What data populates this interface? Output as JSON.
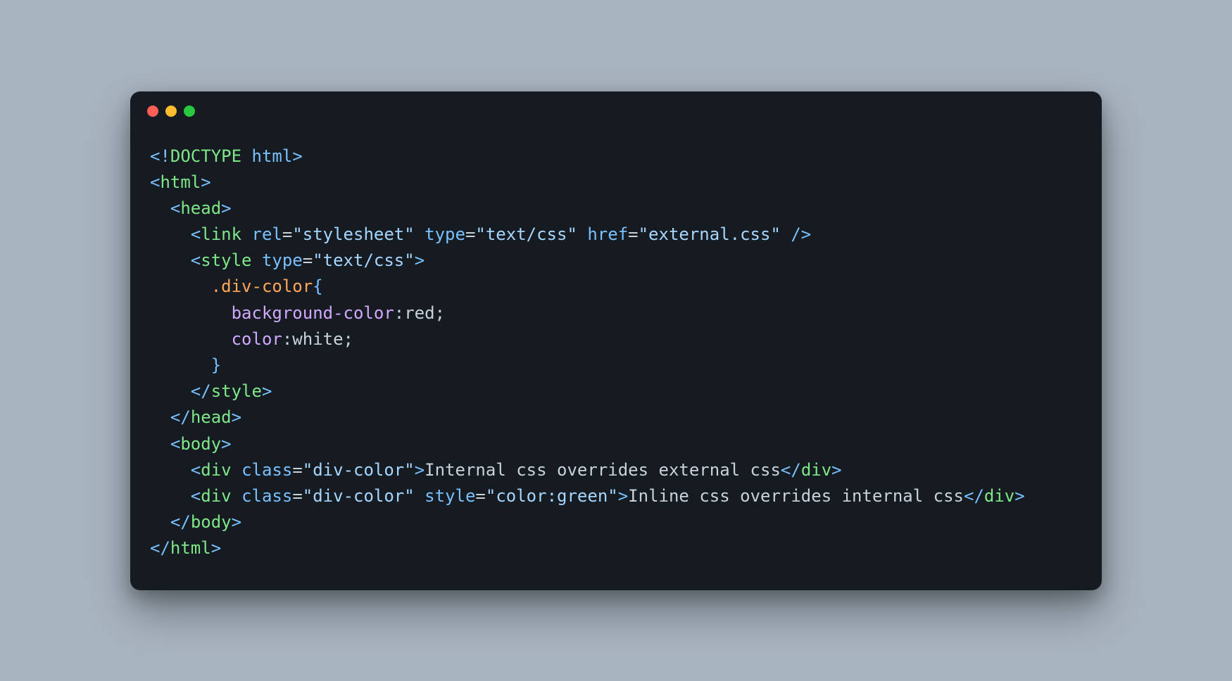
{
  "code": {
    "lines": [
      [
        {
          "cls": "bracket",
          "t": "<!"
        },
        {
          "cls": "tag",
          "t": "DOCTYPE"
        },
        {
          "cls": "text",
          "t": " "
        },
        {
          "cls": "attr",
          "t": "html"
        },
        {
          "cls": "bracket",
          "t": ">"
        }
      ],
      [
        {
          "cls": "bracket",
          "t": "<"
        },
        {
          "cls": "tag",
          "t": "html"
        },
        {
          "cls": "bracket",
          "t": ">"
        }
      ],
      [
        {
          "cls": "text",
          "t": "  "
        },
        {
          "cls": "bracket",
          "t": "<"
        },
        {
          "cls": "tag",
          "t": "head"
        },
        {
          "cls": "bracket",
          "t": ">"
        }
      ],
      [
        {
          "cls": "text",
          "t": "    "
        },
        {
          "cls": "bracket",
          "t": "<"
        },
        {
          "cls": "tag",
          "t": "link"
        },
        {
          "cls": "text",
          "t": " "
        },
        {
          "cls": "attr",
          "t": "rel"
        },
        {
          "cls": "text",
          "t": "="
        },
        {
          "cls": "string",
          "t": "\"stylesheet\""
        },
        {
          "cls": "text",
          "t": " "
        },
        {
          "cls": "attr",
          "t": "type"
        },
        {
          "cls": "text",
          "t": "="
        },
        {
          "cls": "string",
          "t": "\"text/css\""
        },
        {
          "cls": "text",
          "t": " "
        },
        {
          "cls": "attr",
          "t": "href"
        },
        {
          "cls": "text",
          "t": "="
        },
        {
          "cls": "string",
          "t": "\"external.css\""
        },
        {
          "cls": "text",
          "t": " "
        },
        {
          "cls": "bracket",
          "t": "/>"
        }
      ],
      [
        {
          "cls": "text",
          "t": "    "
        },
        {
          "cls": "bracket",
          "t": "<"
        },
        {
          "cls": "tag",
          "t": "style"
        },
        {
          "cls": "text",
          "t": " "
        },
        {
          "cls": "attr",
          "t": "type"
        },
        {
          "cls": "text",
          "t": "="
        },
        {
          "cls": "string",
          "t": "\"text/css\""
        },
        {
          "cls": "bracket",
          "t": ">"
        }
      ],
      [
        {
          "cls": "text",
          "t": "      "
        },
        {
          "cls": "selector",
          "t": ".div-color"
        },
        {
          "cls": "brace",
          "t": "{"
        }
      ],
      [
        {
          "cls": "text",
          "t": "        "
        },
        {
          "cls": "prop",
          "t": "background-color"
        },
        {
          "cls": "text",
          "t": ":"
        },
        {
          "cls": "val",
          "t": "red"
        },
        {
          "cls": "text",
          "t": ";"
        }
      ],
      [
        {
          "cls": "text",
          "t": "        "
        },
        {
          "cls": "prop",
          "t": "color"
        },
        {
          "cls": "text",
          "t": ":"
        },
        {
          "cls": "val",
          "t": "white"
        },
        {
          "cls": "text",
          "t": ";"
        }
      ],
      [
        {
          "cls": "text",
          "t": "      "
        },
        {
          "cls": "brace",
          "t": "}"
        }
      ],
      [
        {
          "cls": "text",
          "t": "    "
        },
        {
          "cls": "bracket",
          "t": "</"
        },
        {
          "cls": "tag",
          "t": "style"
        },
        {
          "cls": "bracket",
          "t": ">"
        }
      ],
      [
        {
          "cls": "text",
          "t": "  "
        },
        {
          "cls": "bracket",
          "t": "</"
        },
        {
          "cls": "tag",
          "t": "head"
        },
        {
          "cls": "bracket",
          "t": ">"
        }
      ],
      [
        {
          "cls": "text",
          "t": "  "
        },
        {
          "cls": "bracket",
          "t": "<"
        },
        {
          "cls": "tag",
          "t": "body"
        },
        {
          "cls": "bracket",
          "t": ">"
        }
      ],
      [
        {
          "cls": "text",
          "t": "    "
        },
        {
          "cls": "bracket",
          "t": "<"
        },
        {
          "cls": "tag",
          "t": "div"
        },
        {
          "cls": "text",
          "t": " "
        },
        {
          "cls": "attr",
          "t": "class"
        },
        {
          "cls": "text",
          "t": "="
        },
        {
          "cls": "string",
          "t": "\"div-color\""
        },
        {
          "cls": "bracket",
          "t": ">"
        },
        {
          "cls": "text",
          "t": "Internal css overrides external css"
        },
        {
          "cls": "bracket",
          "t": "</"
        },
        {
          "cls": "tag",
          "t": "div"
        },
        {
          "cls": "bracket",
          "t": ">"
        }
      ],
      [
        {
          "cls": "text",
          "t": "    "
        },
        {
          "cls": "bracket",
          "t": "<"
        },
        {
          "cls": "tag",
          "t": "div"
        },
        {
          "cls": "text",
          "t": " "
        },
        {
          "cls": "attr",
          "t": "class"
        },
        {
          "cls": "text",
          "t": "="
        },
        {
          "cls": "string",
          "t": "\"div-color\""
        },
        {
          "cls": "text",
          "t": " "
        },
        {
          "cls": "attr",
          "t": "style"
        },
        {
          "cls": "text",
          "t": "="
        },
        {
          "cls": "string",
          "t": "\"color:green\""
        },
        {
          "cls": "bracket",
          "t": ">"
        },
        {
          "cls": "text",
          "t": "Inline css overrides internal css"
        },
        {
          "cls": "bracket",
          "t": "</"
        },
        {
          "cls": "tag",
          "t": "div"
        },
        {
          "cls": "bracket",
          "t": ">"
        }
      ],
      [
        {
          "cls": "text",
          "t": "  "
        },
        {
          "cls": "bracket",
          "t": "</"
        },
        {
          "cls": "tag",
          "t": "body"
        },
        {
          "cls": "bracket",
          "t": ">"
        }
      ],
      [
        {
          "cls": "bracket",
          "t": "</"
        },
        {
          "cls": "tag",
          "t": "html"
        },
        {
          "cls": "bracket",
          "t": ">"
        }
      ]
    ]
  }
}
